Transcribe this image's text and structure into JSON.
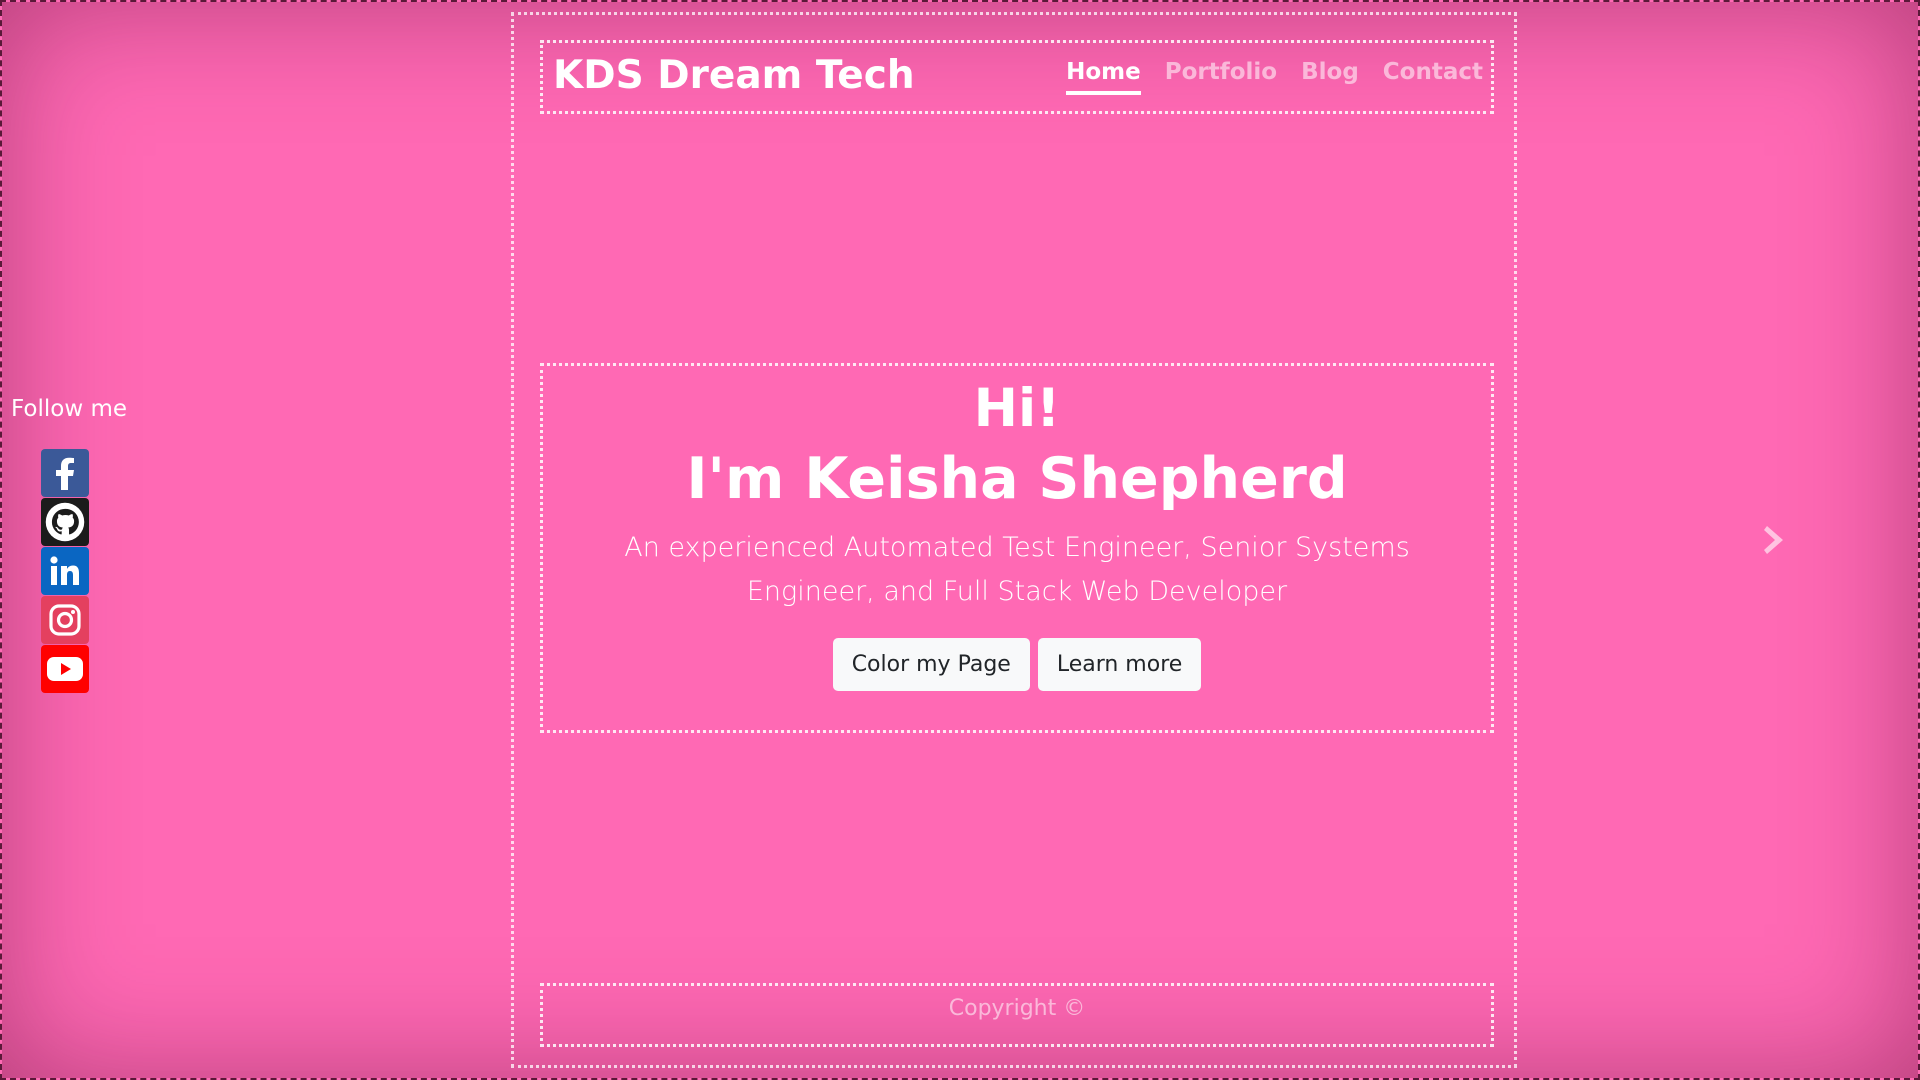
{
  "brand": "KDS Dream Tech",
  "nav": {
    "items": [
      {
        "label": "Home",
        "active": true
      },
      {
        "label": "Portfolio",
        "active": false
      },
      {
        "label": "Blog",
        "active": false
      },
      {
        "label": "Contact",
        "active": false
      }
    ]
  },
  "hero": {
    "greeting": "Hi!",
    "name": "I'm Keisha Shepherd",
    "lead": "An experienced Automated Test Engineer, Senior Systems Engineer, and Full Stack Web Developer",
    "buttons": {
      "color_page": "Color my Page",
      "learn_more": "Learn more"
    }
  },
  "footer": {
    "copyright": "Copyright ©"
  },
  "social": {
    "heading": "Follow me",
    "links": [
      "facebook-icon",
      "github-icon",
      "linkedin-icon",
      "instagram-icon",
      "youtube-icon"
    ]
  },
  "theme": {
    "background": "#ff69b4",
    "text": "#ffffff",
    "button_bg": "#f8f9fa"
  }
}
